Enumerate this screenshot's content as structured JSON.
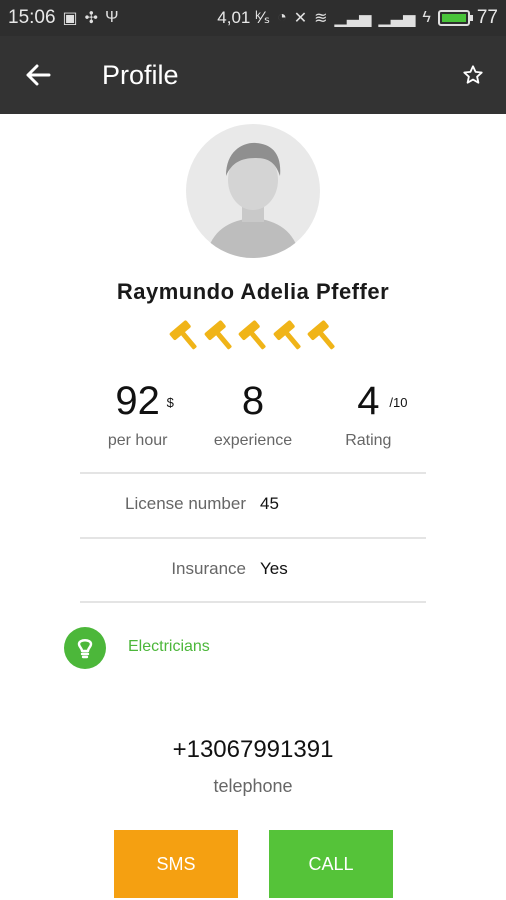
{
  "status_bar": {
    "time": "15:06",
    "speed": "4,01 ᵏ⁄ₛ",
    "battery": "77",
    "battery_level": 0.77
  },
  "app_bar": {
    "title": "Profile",
    "back_icon": "arrow-left-icon",
    "star_icon": "star-outline-icon"
  },
  "profile": {
    "name": "Raymundo Adelia Pfeffer",
    "hammer_rating": 5,
    "stats": [
      {
        "value": "92",
        "sup": "$",
        "label": "per hour"
      },
      {
        "value": "8",
        "sup": "",
        "label": "experience"
      },
      {
        "value": "4",
        "sup": "/10",
        "label": "Rating"
      }
    ],
    "details": [
      {
        "key": "License number",
        "value": "45"
      },
      {
        "key": "Insurance",
        "value": "Yes"
      }
    ],
    "category": "Electricians",
    "phone": "+13067991391",
    "phone_label": "telephone"
  },
  "actions": {
    "sms": "SMS",
    "call": "CALL"
  },
  "colors": {
    "appbar": "#333333",
    "accent_green": "#4cb73a",
    "sms_orange": "#f5a011",
    "call_green": "#55c339",
    "hammer_gold": "#f0b418"
  }
}
